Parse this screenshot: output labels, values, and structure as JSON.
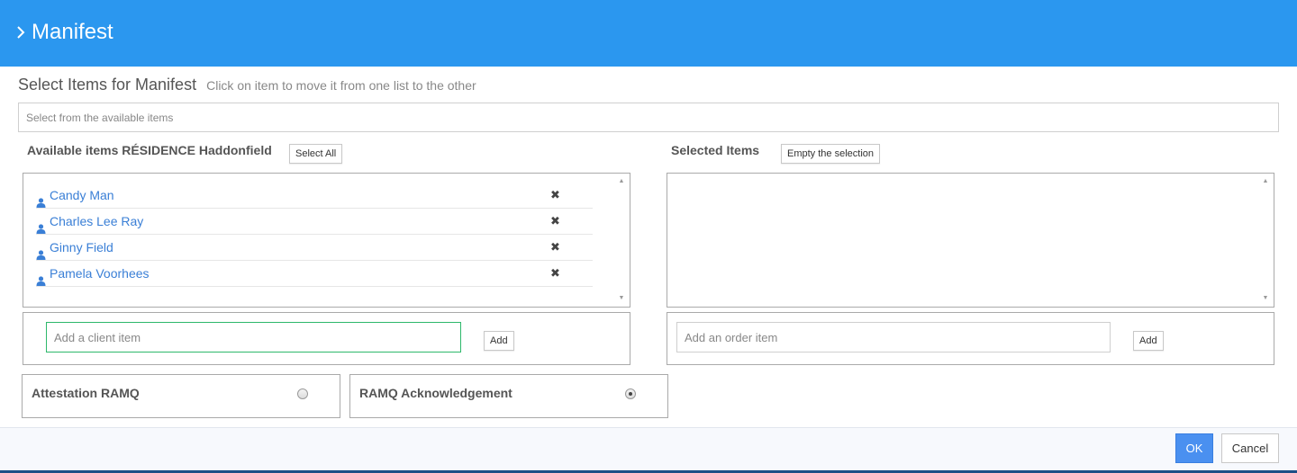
{
  "header": {
    "title": "Manifest",
    "chevron_icon": "chevron-right-icon"
  },
  "section": {
    "title": "Select Items for Manifest",
    "hint": "Click on item to move it from one list to the other"
  },
  "search": {
    "placeholder": "Select from the available items"
  },
  "available": {
    "label": "Available items RÉSIDENCE Haddonfield",
    "select_all_label": "Select All",
    "items": [
      {
        "name": "Candy Man",
        "icon": "user-icon",
        "remove_icon": "remove-icon"
      },
      {
        "name": "Charles Lee Ray",
        "icon": "user-icon",
        "remove_icon": "remove-icon"
      },
      {
        "name": "Ginny Field",
        "icon": "user-icon",
        "remove_icon": "remove-icon"
      },
      {
        "name": "Pamela Voorhees",
        "icon": "user-icon",
        "remove_icon": "remove-icon"
      }
    ],
    "add_placeholder": "Add a client item",
    "add_label": "Add"
  },
  "selected": {
    "label": "Selected Items",
    "empty_label": "Empty the selection",
    "items": [],
    "add_placeholder": "Add an order item",
    "add_label": "Add"
  },
  "options": [
    {
      "label": "Attestation RAMQ",
      "selected": false
    },
    {
      "label": "RAMQ Acknowledgement",
      "selected": true
    }
  ],
  "footer": {
    "ok_label": "OK",
    "cancel_label": "Cancel"
  },
  "colors": {
    "header": "#2b97ef",
    "link": "#3a7fd6",
    "ok_button": "#4a90f0",
    "focus_border": "#2eb86b"
  }
}
